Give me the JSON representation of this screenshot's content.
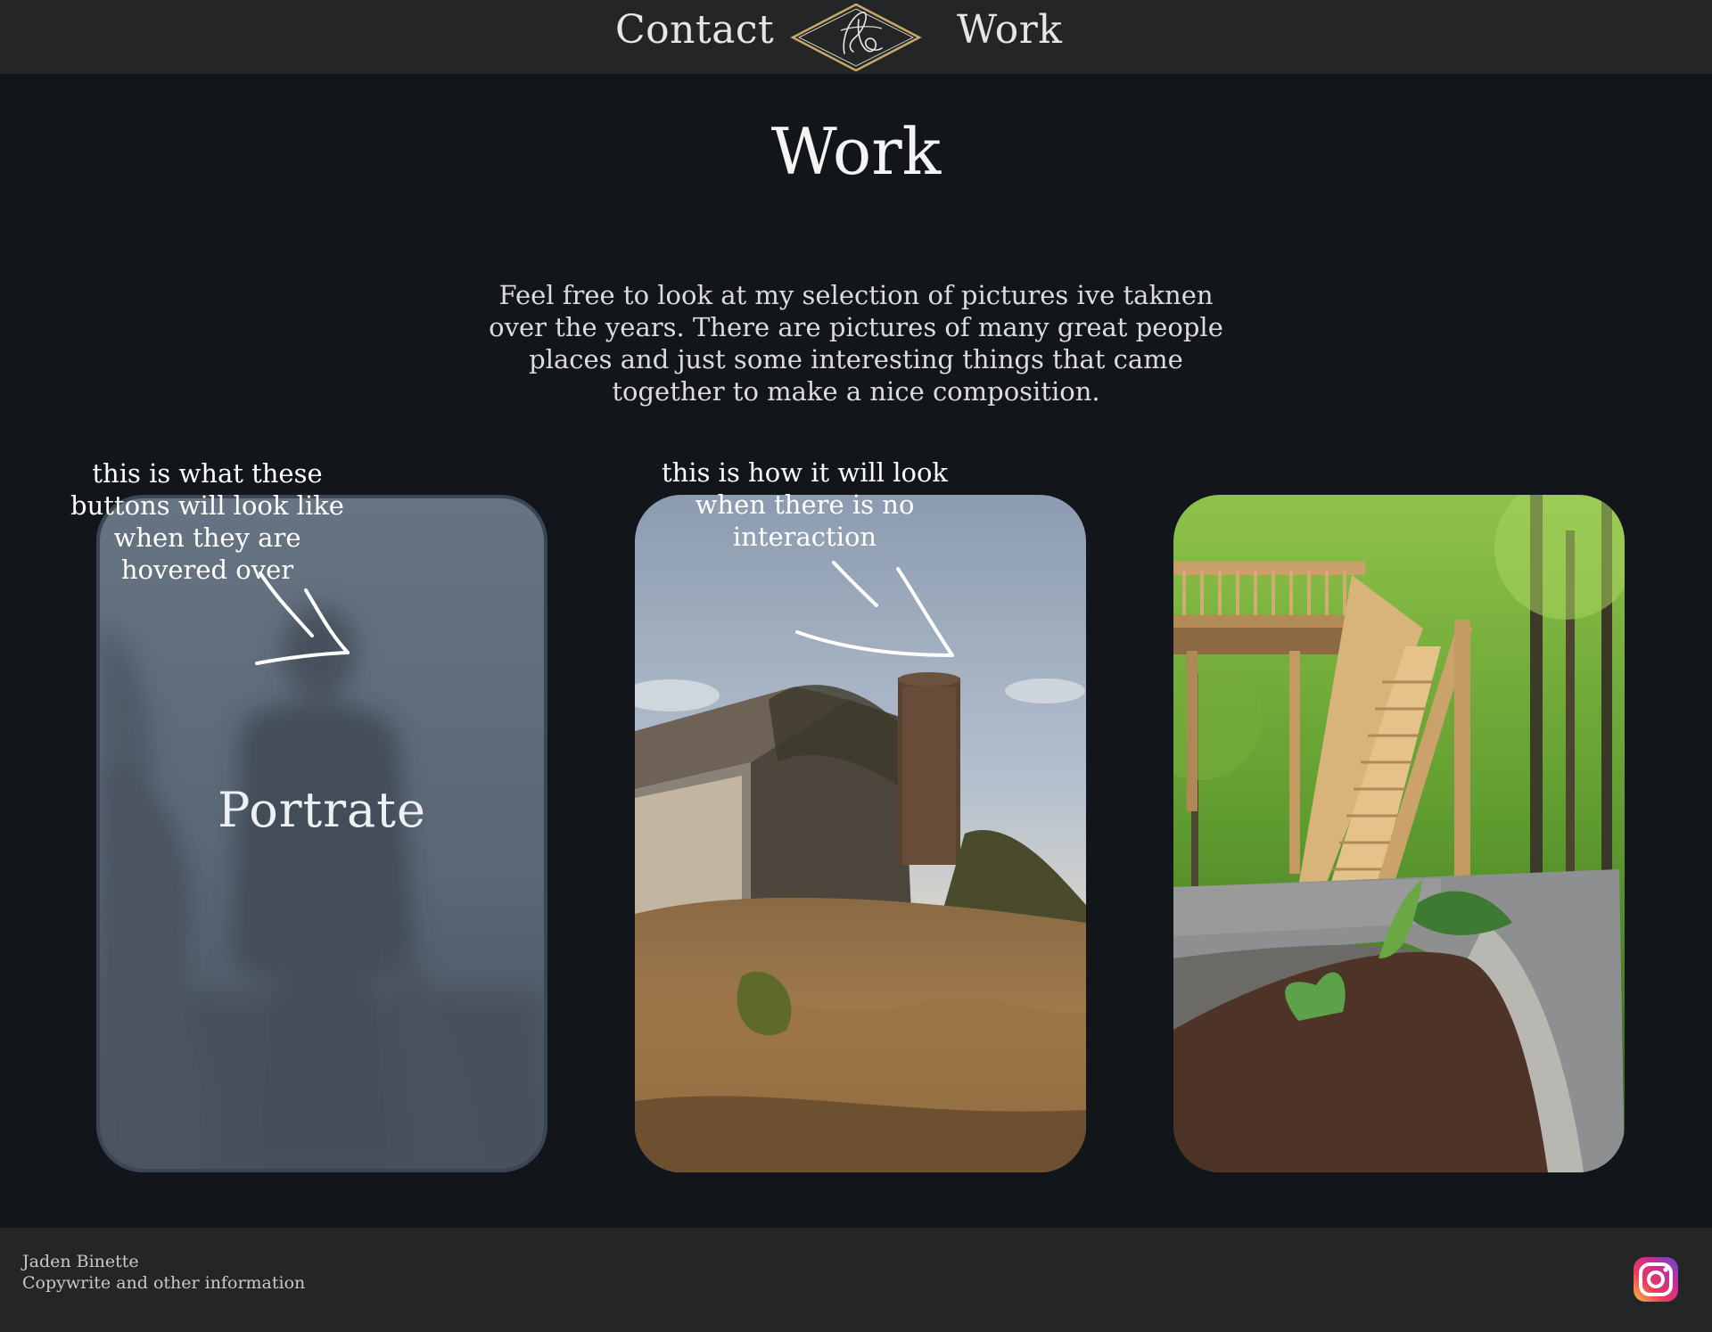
{
  "header": {
    "nav": [
      {
        "label": "Contact"
      },
      {
        "label": "Work"
      }
    ],
    "logo_icon": "signature-diamond-logo"
  },
  "main": {
    "title": "Work",
    "intro": "Feel free to look at my selection of pictures ive taknen over the years. There are pictures of many great people places and just some interesting things that came together to make a nice composition.",
    "cards": [
      {
        "label": "Portrate",
        "state": "hovered",
        "photo": "blurred portrait of a hooded figure"
      },
      {
        "label": "",
        "state": "idle",
        "photo": "old barn with silo"
      },
      {
        "label": "",
        "state": "idle",
        "photo": "wooden deck stairs in forest"
      }
    ]
  },
  "annotations": {
    "hover_note": "this is what these buttons will look like when they are hovered over",
    "idle_note": "this is how it will look when there is no interaction"
  },
  "footer": {
    "name": "Jaden Binette",
    "info": "Copywrite and other information",
    "social_icon": "instagram-icon"
  },
  "colors": {
    "page_bg": "#12151a",
    "bar_bg": "#242526",
    "logo_gold": "#c8a968",
    "hover_overlay": "#5f6e80"
  }
}
